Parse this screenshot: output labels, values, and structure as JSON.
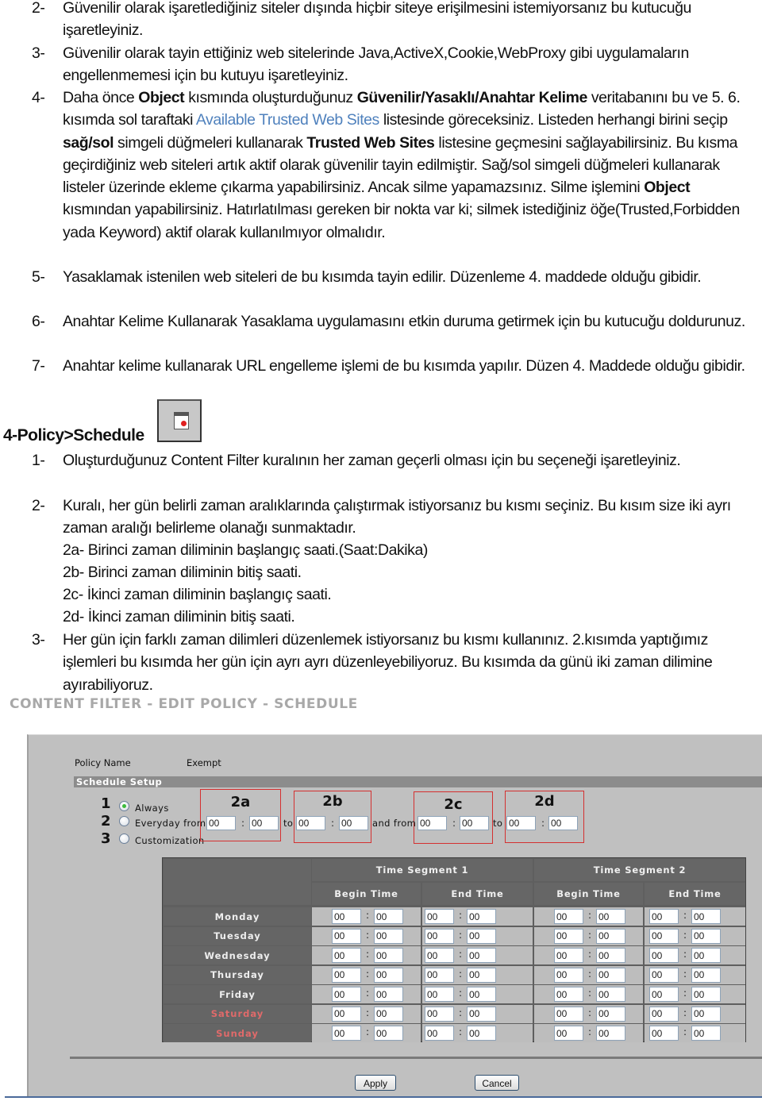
{
  "document": {
    "list_a": [
      {
        "num": "2-",
        "html_parts": [
          {
            "t": "Güvenilir olarak işaretlediğiniz siteler dışında hiçbir siteye erişilmesini istemiyorsanız bu kutucuğu işaretleyiniz."
          }
        ]
      },
      {
        "num": "3-",
        "html_parts": [
          {
            "t": "Güvenilir olarak tayin ettiğiniz web sitelerinde Java,ActiveX,Cookie,WebProxy gibi uygulamaların engellenmemesi için bu kutuyu işaretleyiniz."
          }
        ]
      },
      {
        "num": "4-",
        "html_parts": [
          {
            "t": "Daha önce "
          },
          {
            "t": "Object",
            "b": true
          },
          {
            "t": " kısmında oluşturduğunuz "
          },
          {
            "t": "Güvenilir/Yasaklı/Anahtar Kelime",
            "b": true
          },
          {
            "t": " veritabanını bu ve 5. 6. kısımda sol taraftaki "
          },
          {
            "t": "Available Trusted Web Sites",
            "link": true
          },
          {
            "t": " listesinde göreceksiniz. Listeden herhangi birini seçip "
          },
          {
            "t": "sağ/sol",
            "b": true
          },
          {
            "t": " simgeli düğmeleri kullanarak "
          },
          {
            "t": "Trusted Web Sites",
            "b": true
          },
          {
            "t": " listesine geçmesini sağlayabilirsiniz. Bu kısma geçirdiğiniz web siteleri artık aktif olarak güvenilir tayin edilmiştir. Sağ/sol simgeli düğmeleri kullanarak listeler üzerinde ekleme çıkarma yapabilirsiniz. Ancak silme yapamazsınız. Silme işlemini "
          },
          {
            "t": "Object",
            "b": true
          },
          {
            "t": " kısmından yapabilirsiniz. Hatırlatılması gereken bir nokta var ki; silmek istediğiniz öğe(Trusted,Forbidden yada Keyword) aktif olarak kullanılmıyor olmalıdır."
          }
        ]
      },
      {
        "num": "5-",
        "html_parts": [
          {
            "t": "Yasaklamak istenilen web siteleri de bu kısımda tayin edilir. Düzenleme 4. maddede olduğu gibidir."
          }
        ]
      },
      {
        "num": "6-",
        "html_parts": [
          {
            "t": "Anahtar Kelime Kullanarak Yasaklama uygulamasını etkin duruma getirmek için bu kutucuğu doldurunuz."
          }
        ]
      },
      {
        "num": "7-",
        "html_parts": [
          {
            "t": "Anahtar kelime kullanarak URL engelleme işlemi de bu kısımda yapılır. Düzen 4. Maddede olduğu gibidir."
          }
        ]
      }
    ],
    "section_heading": "4-Policy>Schedule",
    "section_icon": "schedule-calendar-icon",
    "list_b": [
      {
        "num": "1-",
        "text": "Oluşturduğunuz Content Filter kuralının her zaman geçerli olması için bu seçeneği işaretleyiniz."
      },
      {
        "num": "2-",
        "text": "Kuralı,  her gün belirli zaman aralıklarında çalıştırmak istiyorsanız bu kısmı seçiniz. Bu kısım size iki ayrı zaman aralığı belirleme olanağı sunmaktadır."
      }
    ],
    "sub_items": [
      "2a- Birinci zaman diliminin başlangıç saati.(Saat:Dakika)",
      "2b- Birinci zaman diliminin bitiş saati.",
      "2c- İkinci zaman diliminin başlangıç saati.",
      "2d- İkinci zaman diliminin bitiş saati."
    ],
    "list_c": [
      {
        "num": "3-",
        "text": "Her gün için farklı zaman dilimleri düzenlemek istiyorsanız bu kısmı kullanınız. 2.kısımda yaptığımız işlemleri bu kısımda her gün için ayrı ayrı düzenleyebiliyoruz. Bu kısımda da günü iki zaman dilimine ayırabiliyoruz."
      }
    ]
  },
  "screenshot": {
    "title": "CONTENT FILTER - EDIT POLICY - SCHEDULE",
    "policy_name_label": "Policy Name",
    "policy_name_value": "Exempt",
    "setup_header": "Schedule Setup",
    "options": [
      {
        "num": "1",
        "label": "Always",
        "selected": true
      },
      {
        "num": "2",
        "label": "Everyday from",
        "selected": false
      },
      {
        "num": "3",
        "label": "Customization",
        "selected": false
      }
    ],
    "everyday": {
      "from1_h": "00",
      "from1_m": "00",
      "to_label": "to",
      "to1_h": "00",
      "to1_m": "00",
      "and_from_label": "and from",
      "from2_h": "00",
      "from2_m": "00",
      "to2_label": "to",
      "to2_h": "00",
      "to2_m": "00",
      "colon": ":"
    },
    "annotations": [
      "2a",
      "2b",
      "2c",
      "2d"
    ],
    "annotation_color": "#d43030",
    "table": {
      "segment_headers": [
        "Time Segment 1",
        "Time Segment 2"
      ],
      "sub_headers": [
        "Begin Time",
        "End Time",
        "Begin Time",
        "End Time"
      ],
      "days": [
        {
          "name": "Monday",
          "weekend": false,
          "times": [
            "00",
            "00",
            "00",
            "00",
            "00",
            "00",
            "00",
            "00"
          ]
        },
        {
          "name": "Tuesday",
          "weekend": false,
          "times": [
            "00",
            "00",
            "00",
            "00",
            "00",
            "00",
            "00",
            "00"
          ]
        },
        {
          "name": "Wednesday",
          "weekend": false,
          "times": [
            "00",
            "00",
            "00",
            "00",
            "00",
            "00",
            "00",
            "00"
          ]
        },
        {
          "name": "Thursday",
          "weekend": false,
          "times": [
            "00",
            "00",
            "00",
            "00",
            "00",
            "00",
            "00",
            "00"
          ]
        },
        {
          "name": "Friday",
          "weekend": false,
          "times": [
            "00",
            "00",
            "00",
            "00",
            "00",
            "00",
            "00",
            "00"
          ]
        },
        {
          "name": "Saturday",
          "weekend": true,
          "times": [
            "00",
            "00",
            "00",
            "00",
            "00",
            "00",
            "00",
            "00"
          ]
        },
        {
          "name": "Sunday",
          "weekend": true,
          "times": [
            "00",
            "00",
            "00",
            "00",
            "00",
            "00",
            "00",
            "00"
          ]
        }
      ],
      "weekend_color": "#e06a6a"
    },
    "apply_label": "Apply",
    "cancel_label": "Cancel"
  }
}
